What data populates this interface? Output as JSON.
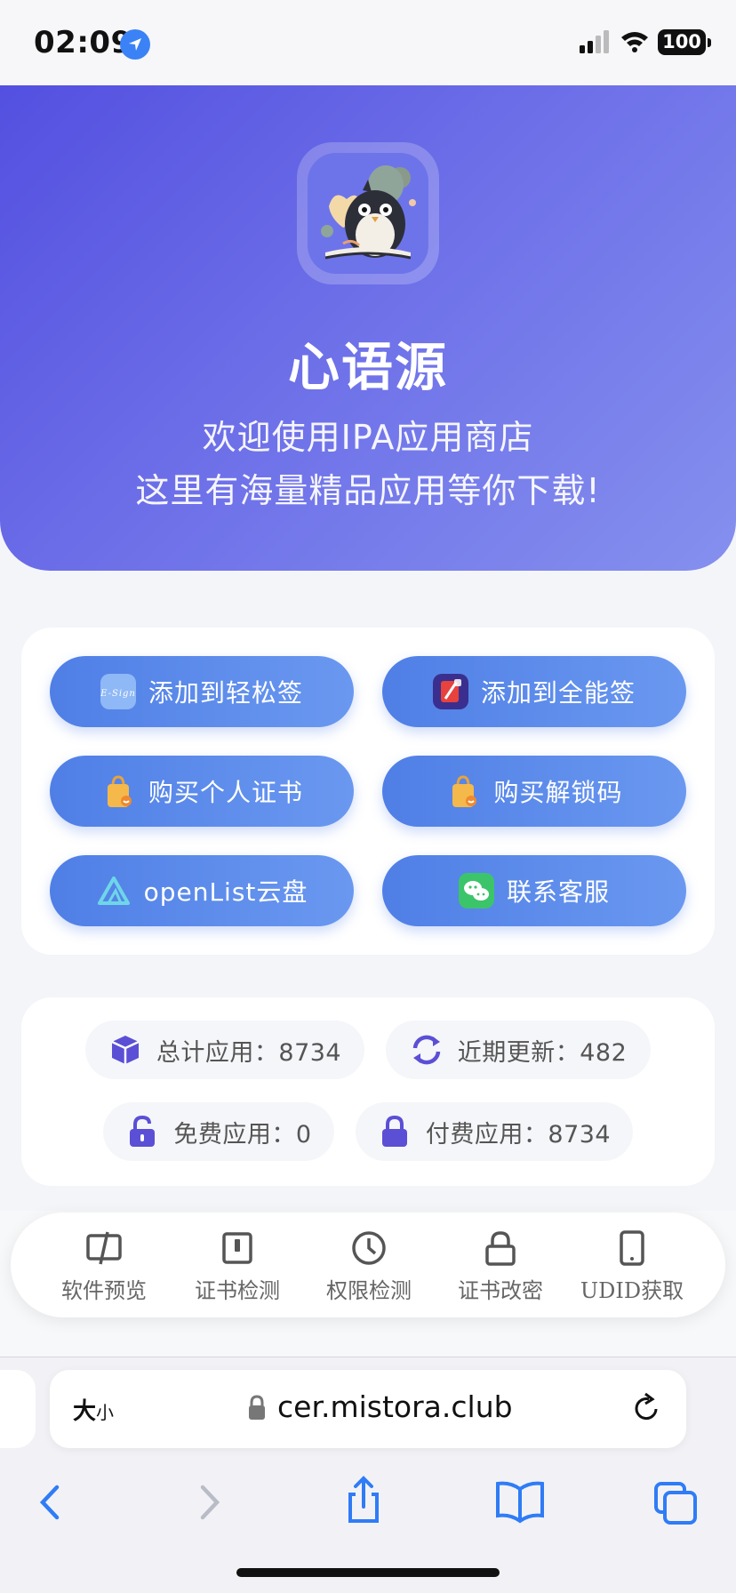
{
  "status_bar": {
    "time": "02:09",
    "battery": "100"
  },
  "hero": {
    "title": "心语源",
    "subtitle_line1": "欢迎使用IPA应用商店",
    "subtitle_line2": "这里有海量精品应用等你下载!"
  },
  "action_buttons": [
    {
      "label": "添加到轻松签",
      "icon": "esign-app-icon",
      "icon_text": "E-Sign"
    },
    {
      "label": "添加到全能签",
      "icon": "quanneng-app-icon"
    },
    {
      "label": "购买个人证书",
      "icon": "shopping-bag-icon"
    },
    {
      "label": "购买解锁码",
      "icon": "shopping-bag-icon"
    },
    {
      "label": "openList云盘",
      "icon": "openlist-icon"
    },
    {
      "label": "联系客服",
      "icon": "wechat-icon"
    }
  ],
  "stats": {
    "total": "总计应用：8734",
    "recent": "近期更新：482",
    "free": "免费应用：0",
    "paid": "付费应用：8734"
  },
  "tools": [
    {
      "label": "软件预览",
      "icon": "preview-icon"
    },
    {
      "label": "证书检测",
      "icon": "certificate-icon"
    },
    {
      "label": "权限检测",
      "icon": "clock-icon"
    },
    {
      "label": "证书改密",
      "icon": "lock-icon"
    },
    {
      "label": "UDID获取",
      "icon": "phone-icon"
    }
  ],
  "browser": {
    "text_size_big": "大",
    "text_size_small": "小",
    "url": "cer.mistora.club"
  },
  "colors": {
    "hero_gradient_start": "#5350e0",
    "hero_gradient_end": "#8590ee",
    "button_blue": "#4f7fe6",
    "stat_icon_purple": "#5b4fd6",
    "accent_blue": "#2f7cf6"
  }
}
